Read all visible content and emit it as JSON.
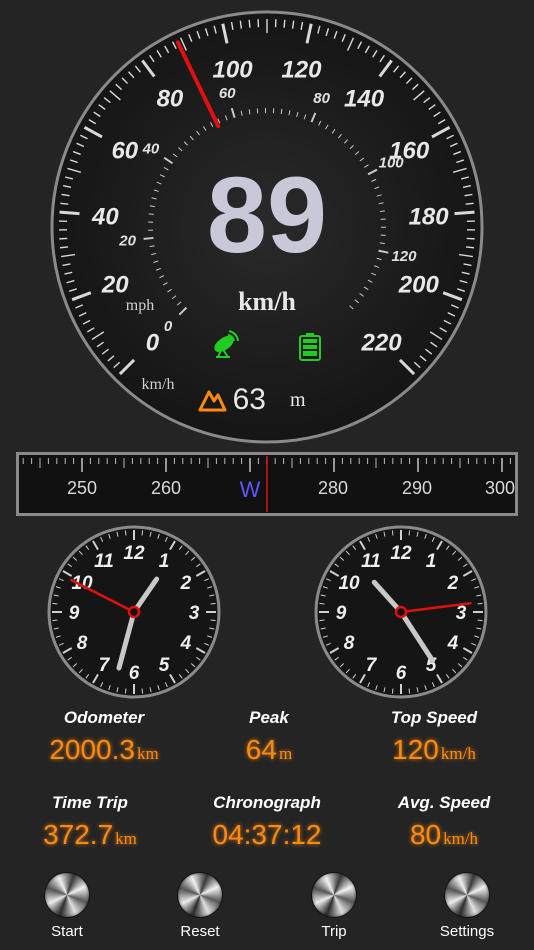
{
  "speedometer": {
    "speed": "89",
    "unit": "km/h",
    "kmh_label": "km/h",
    "mph_label": "mph",
    "kmh_ticks": [
      "0",
      "20",
      "40",
      "60",
      "80",
      "100",
      "120",
      "140",
      "160",
      "180",
      "200",
      "220"
    ],
    "mph_ticks": [
      "0",
      "20",
      "40",
      "60",
      "80",
      "100",
      "120"
    ],
    "needle_kmh": 89,
    "altitude": "63",
    "altitude_unit": "m",
    "gps_icon": "satellite-dish-icon",
    "battery_icon": "battery-icon",
    "altitude_icon": "mountain-icon",
    "needle_color": "#e01010",
    "status_green": "#22cc22",
    "altitude_icon_color": "#ff8a10"
  },
  "compass": {
    "heading_label": "W",
    "heading_deg": 270,
    "tick_labels": [
      "250",
      "260",
      "280",
      "290",
      "300"
    ],
    "heading_color": "#5a5aff"
  },
  "clocks": {
    "numbers": [
      "12",
      "1",
      "2",
      "3",
      "4",
      "5",
      "6",
      "7",
      "8",
      "9",
      "10",
      "11"
    ],
    "left": {
      "hour": 1.15,
      "minute": 32.5,
      "second": 49.5
    },
    "right": {
      "hour": 10.6,
      "minute": 24.5,
      "second": 13.8
    }
  },
  "stats": {
    "odometer": {
      "label": "Odometer",
      "value": "2000.3",
      "unit": "km"
    },
    "peak": {
      "label": "Peak",
      "value": "64",
      "unit": "m"
    },
    "top_speed": {
      "label": "Top Speed",
      "value": "120",
      "unit": "km/h"
    },
    "time_trip": {
      "label": "Time Trip",
      "value": "372.7",
      "unit": "km"
    },
    "chronograph": {
      "label": "Chronograph",
      "value": "04:37:12",
      "unit": ""
    },
    "avg_speed": {
      "label": "Avg. Speed",
      "value": "80",
      "unit": "km/h"
    }
  },
  "buttons": {
    "start": "Start",
    "reset": "Reset",
    "trip": "Trip",
    "settings": "Settings"
  },
  "colors": {
    "accent": "#ff8a10",
    "background": "#242424"
  }
}
